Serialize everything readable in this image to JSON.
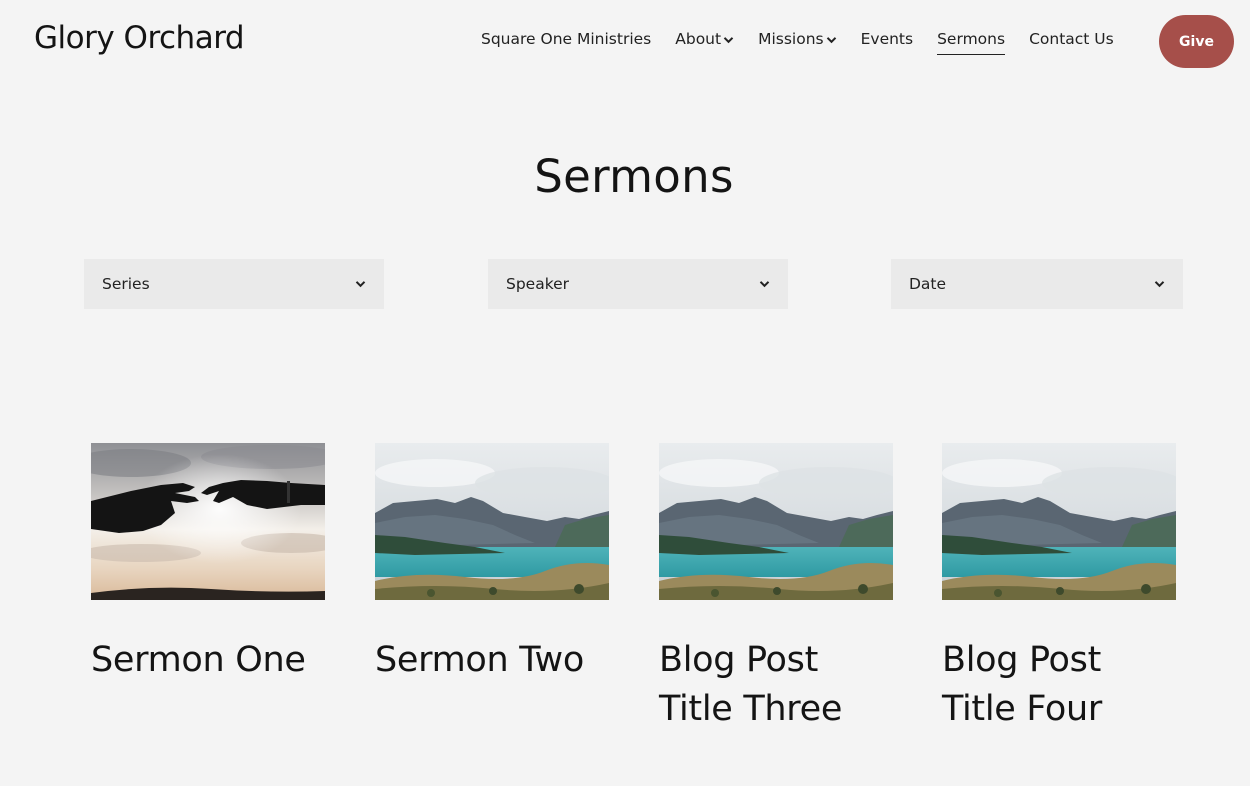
{
  "header": {
    "site_title": "Glory Orchard",
    "nav": [
      {
        "label": "Square One Ministries"
      },
      {
        "label": "About"
      },
      {
        "label": "Missions"
      },
      {
        "label": "Events"
      },
      {
        "label": "Sermons"
      },
      {
        "label": "Contact Us"
      }
    ],
    "give_label": "Give"
  },
  "main": {
    "heading": "Sermons",
    "filters": [
      {
        "label": "Series"
      },
      {
        "label": "Speaker"
      },
      {
        "label": "Date"
      }
    ],
    "cards": [
      {
        "title": "Sermon One",
        "image": "hands-reaching-image"
      },
      {
        "title": "Sermon Two",
        "image": "mountain-lake-image"
      },
      {
        "title": "Blog Post Title Three",
        "image": "mountain-lake-image"
      },
      {
        "title": "Blog Post Title Four",
        "image": "mountain-lake-image"
      }
    ]
  },
  "colors": {
    "background": "#f4f4f4",
    "give_button": "#a64f4a",
    "filter_bg": "#eaeaea",
    "text": "#141414"
  },
  "icons": {
    "dropdown": "chevron-down-icon"
  }
}
